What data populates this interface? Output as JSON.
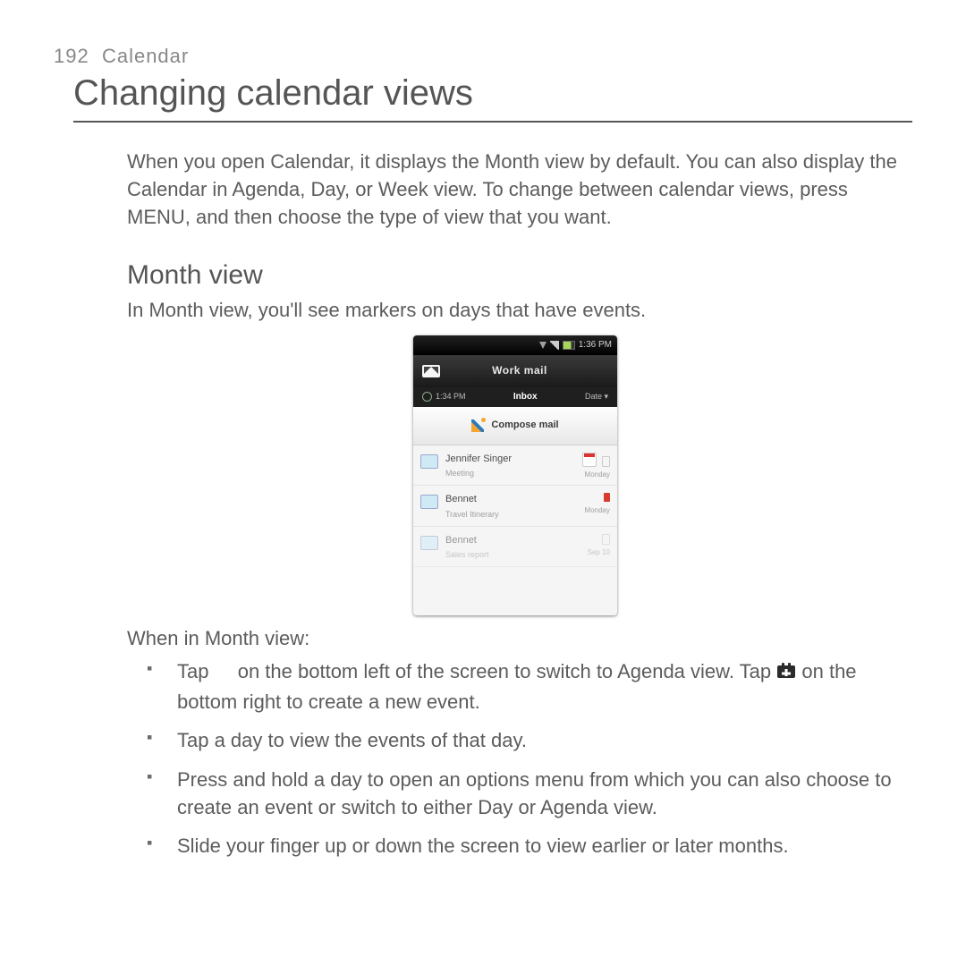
{
  "page": {
    "number": "192",
    "chapter": "Calendar"
  },
  "title": "Changing calendar views",
  "intro": "When you open Calendar, it displays the Month view by default. You can also display the Calendar in Agenda, Day, or Week view. To change between calendar views, press MENU, and then choose the type of view that you want.",
  "section": {
    "heading": "Month view",
    "line": "In Month view, you'll see markers on days that have events."
  },
  "month_view_caption": "When in Month view:",
  "bullets": {
    "b1a": "Tap ",
    "b1b": " on the bottom left of the screen to switch to Agenda view. Tap ",
    "b1c": " on the bottom right to create a new event.",
    "b2": "Tap a day to view the events of that day.",
    "b3": "Press and hold a day to open an options menu from which you can also choose to create an event or switch to either Day or Agenda view.",
    "b4": "Slide your finger up or down the screen to view earlier or later months."
  },
  "phone": {
    "time": "1:36 PM",
    "title": "Work mail",
    "sync_time": "1:34 PM",
    "folder": "Inbox",
    "date": "Date ▾",
    "compose": "Compose mail",
    "rows": [
      {
        "name": "Jennifer Singer",
        "subj": "Meeting",
        "date": "Monday"
      },
      {
        "name": "Bennet",
        "subj": "Travel Itinerary",
        "date": "Monday"
      },
      {
        "name": "Bennet",
        "subj": "Sales report",
        "date": "Sep 10"
      }
    ]
  }
}
